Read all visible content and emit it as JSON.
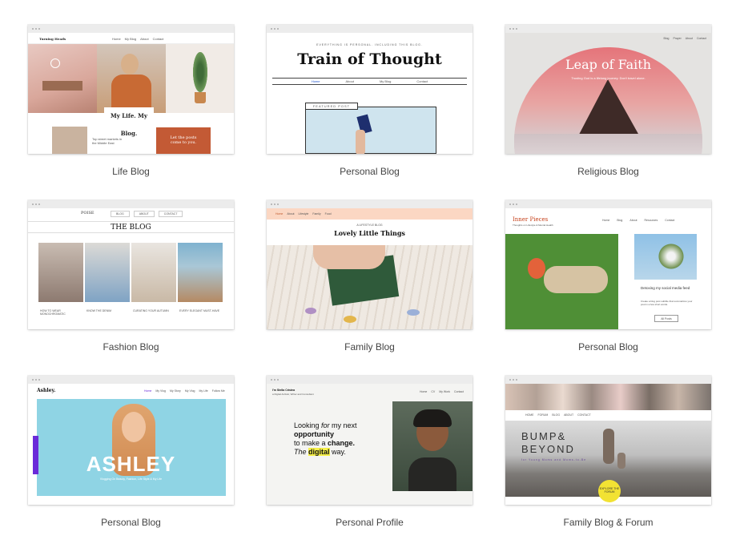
{
  "templates": [
    {
      "caption": "Life Blog",
      "site_name": "Turning Heads",
      "nav": [
        "Home",
        "My Blog",
        "About",
        "Contact"
      ],
      "headline": "My Life. My Blog.",
      "post_title": "Top street markets in the Middle East",
      "cta": "Let the posts come to you."
    },
    {
      "caption": "Personal Blog",
      "tagline": "EVERYTHING IS PERSONAL. INCLUDING THIS BLOG.",
      "title": "Train of Thought",
      "nav": [
        "Home",
        "About",
        "My Blog",
        "Contact"
      ],
      "featured_label": "FEATURED POST"
    },
    {
      "caption": "Religious Blog",
      "nav": [
        "Blog",
        "Prayer",
        "About",
        "Contact"
      ],
      "title": "Leap of Faith",
      "subtitle": "Trusting God is a lifelong journey. Don't travel alone."
    },
    {
      "caption": "Fashion Blog",
      "site_name": "POISE",
      "nav": [
        "BLOG",
        "ABOUT",
        "CONTACT"
      ],
      "heading": "THE BLOG",
      "posts": [
        "HOW TO WEAR MONOCHROMATIC",
        "KNOW THE DENIM",
        "CURATING YOUR AUTUMN",
        "EVERY ELEGANT MUST-HAVE"
      ]
    },
    {
      "caption": "Family Blog",
      "nav": [
        "Home",
        "About",
        "Lifestyle",
        "Family",
        "Food"
      ],
      "kicker": "A LIFESTYLE BLOG",
      "title": "Lovely Little Things"
    },
    {
      "caption": "Personal Blog",
      "title": "Inner Pieces",
      "subtitle": "Thoughts on Lifestyle & Mental Health",
      "nav": [
        "Home",
        "Blog",
        "About",
        "Resources",
        "Contact"
      ],
      "post_title": "Detoxing my social media feed",
      "post_excerpt": "Create a blog post subtitle that summarizes your post in a few short words.",
      "button": "All Posts"
    },
    {
      "caption": "Personal Blog",
      "site_name": "Ashley.",
      "nav": [
        "Home",
        "My Vlog",
        "My Story",
        "My Vlog",
        "My Life",
        "Follow Me"
      ],
      "hero_name": "ASHLEY",
      "hero_sub": "Vlogging On Beauty, Fashion, Life Style & My Life"
    },
    {
      "caption": "Personal Profile",
      "site_name": "I'm Stella Cristea",
      "site_sub": "a Digital Activist, Writer and Consultant",
      "nav": [
        "Home",
        "CV",
        "My Work",
        "Contact"
      ],
      "line1_a": "Looking ",
      "line1_b": "for",
      "line1_c": " my next",
      "line2": "opportunity",
      "line3_a": "to make a ",
      "line3_b": "change.",
      "line4_a": "The ",
      "line4_b": "digital",
      "line4_c": " way."
    },
    {
      "caption": "Family Blog & Forum",
      "nav": [
        "HOME",
        "FORUM",
        "BLOG",
        "ABOUT",
        "CONTACT"
      ],
      "title_1": "BUMP&",
      "title_2": "BEYOND",
      "subtitle": "for Young Moms and Moms-to-Be",
      "badge": "EXPLORE THE FORUM"
    }
  ]
}
